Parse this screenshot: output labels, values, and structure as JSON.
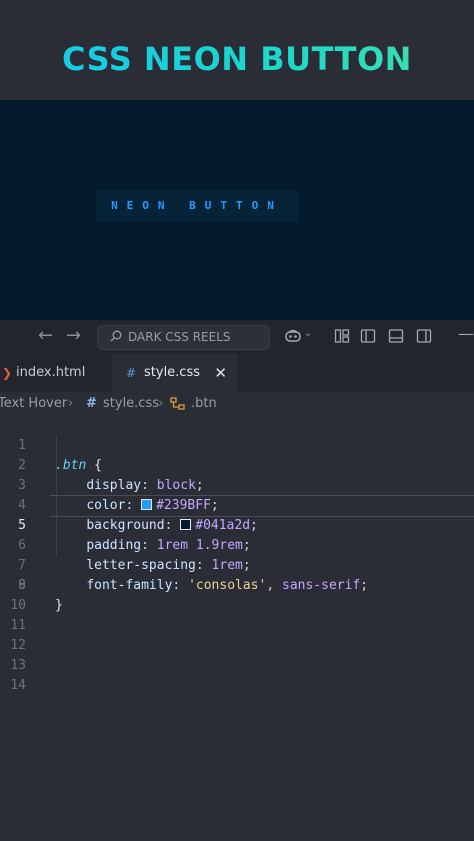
{
  "banner": {
    "title": "CSS NEON BUTTON"
  },
  "preview": {
    "button_label": "NEON BUTTON"
  },
  "titlebar": {
    "search_placeholder": "DARK CSS REELS",
    "back_icon": "arrow-left-icon",
    "forward_icon": "arrow-right-icon"
  },
  "tabs": [
    {
      "label": "index.html",
      "icon": "html-file-icon"
    },
    {
      "label": "style.css",
      "icon": "css-file-icon",
      "close": "✕"
    }
  ],
  "breadcrumb": {
    "folder": "Text Hover",
    "file": "style.css",
    "selector": ".btn"
  },
  "editor": {
    "active_line": 5,
    "line_numbers": [
      "1",
      "2",
      "3",
      "4",
      "5",
      "6",
      "7",
      "8",
      "9",
      "10",
      "11",
      "12",
      "13",
      "14"
    ],
    "code": {
      "selector": ".btn",
      "open": " {",
      "close": "}",
      "decls": [
        {
          "prop": "display",
          "val": "block"
        },
        {
          "prop": "color",
          "val": "#239BFF",
          "swatch": "#239bff"
        },
        {
          "prop": "background",
          "val": "#041a2d",
          "swatch": "#041a2d"
        },
        {
          "prop": "padding",
          "val": "1rem 1.9rem"
        },
        {
          "prop": "letter-spacing",
          "val": "1rem"
        },
        {
          "prop": "font-family",
          "str": "'consolas'",
          "val": "sans-serif"
        }
      ]
    }
  },
  "colors": {
    "neon_blue": "#239bff",
    "preview_bg": "#041a2d",
    "editor_bg": "#2a2c36"
  }
}
